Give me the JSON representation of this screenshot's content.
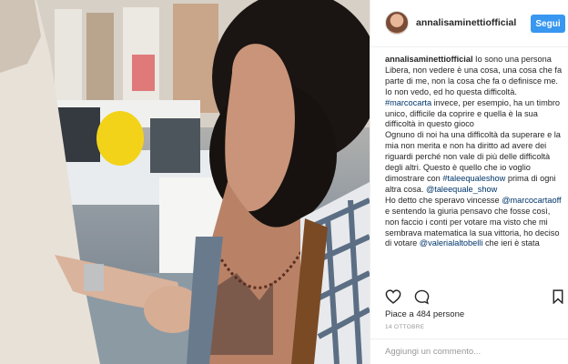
{
  "header": {
    "username": "annalisaminettiofficial",
    "follow_label": "Segui"
  },
  "caption": {
    "username": "annalisaminettiofficial",
    "text1": " Io sono una persona Libera, non vedere è una cosa, una cosa che fa parte di me, non la cosa che fa o definisce me. Io non vedo, ed ho questa difficoltà. ",
    "tag1": "#marcocarta",
    "text2": " invece, per esempio, ha un timbro unico, difficile da coprire e quella è la sua difficoltà in questo gioco",
    "text3": "Ognuno di noi ha una difficoltà da superare e la mia non merita e non ha diritto ad avere dei riguardi perché non vale di più delle difficoltà degli altri. Questo è quello che io voglio dimostrare con ",
    "tag2": "#taleequaleshow",
    "text4": " prima di ogni altra cosa. ",
    "tag3": "@taleequale_show",
    "text5": "Ho detto che speravo vincesse ",
    "tag4": "@marcocartaoff",
    "text6": " e sentendo la giuria pensavo che fosse così, non faccio i conti per votare ma visto che mi sembrava matematica la sua vittoria, ho deciso di votare ",
    "tag5": "@valerialaltobelli",
    "text7": " che ieri è stata"
  },
  "actions": {
    "like_icon": "heart-icon",
    "comment_icon": "comment-bubble-icon",
    "save_icon": "bookmark-icon"
  },
  "likes_text": "Piace a 484 persone",
  "date_text": "14 OTTOBRE",
  "comment": {
    "placeholder": "Aggiungi un commento..."
  },
  "colors": {
    "follow_button": "#3897f0",
    "link": "#003569"
  }
}
